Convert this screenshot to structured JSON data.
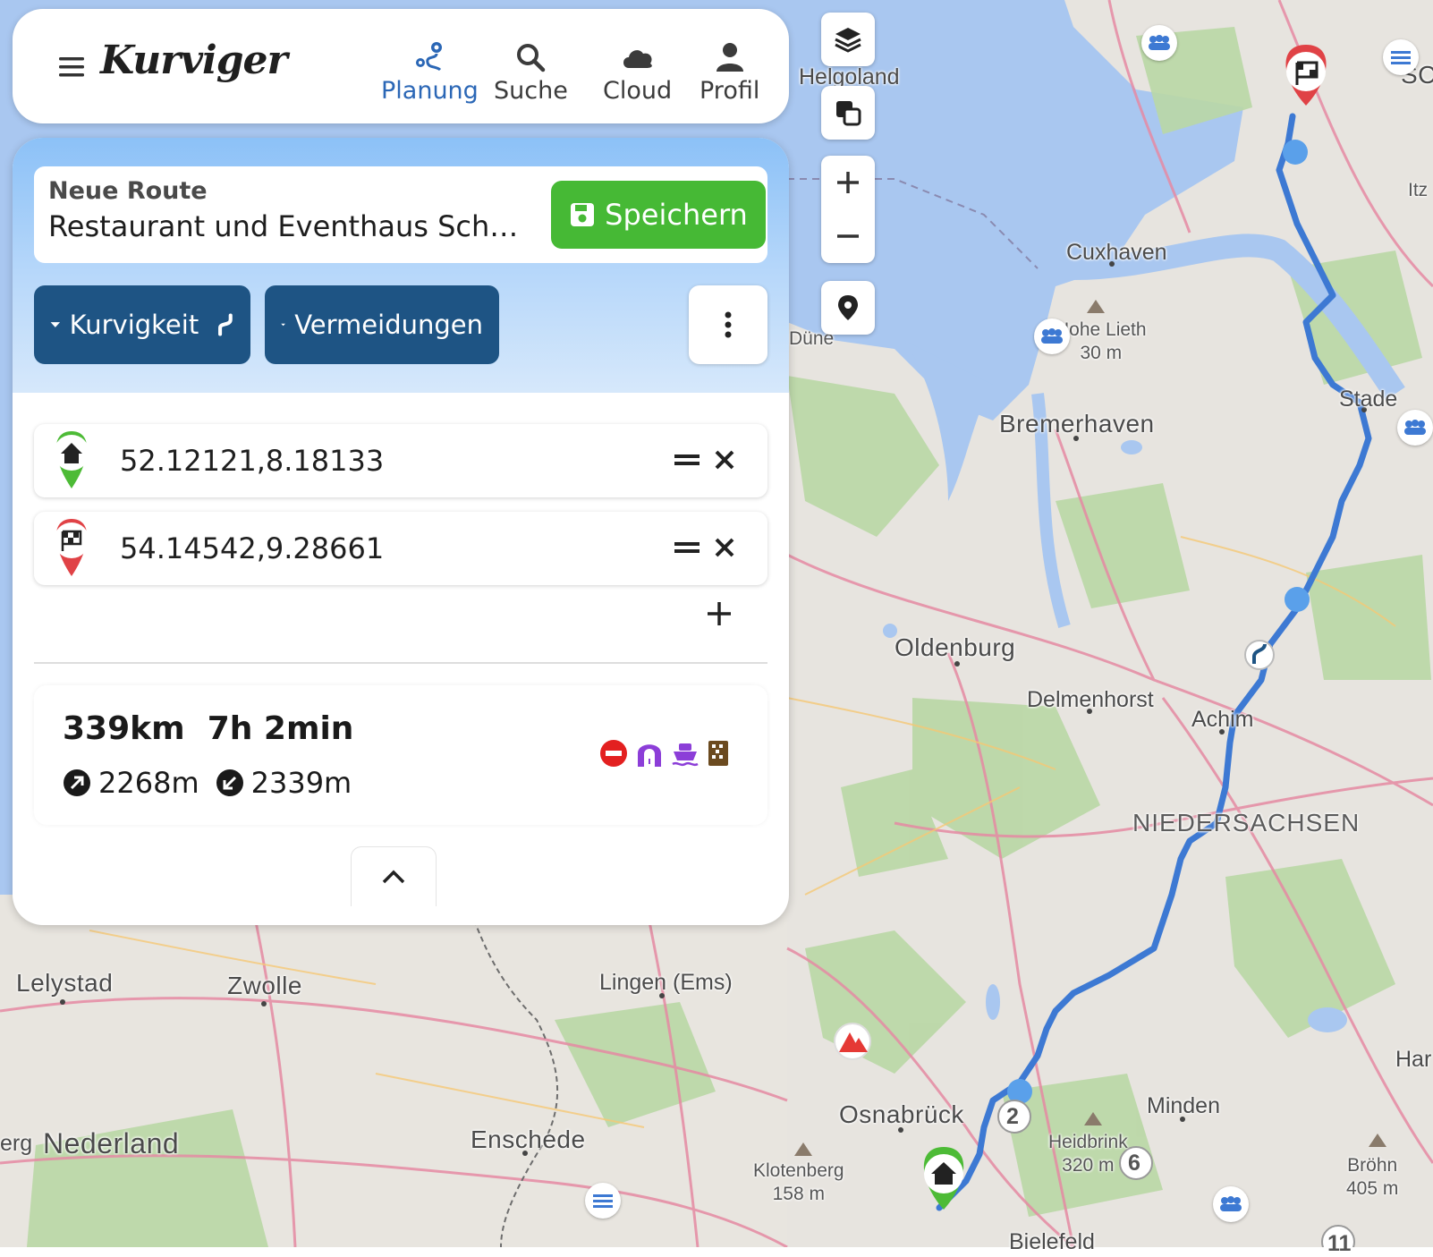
{
  "nav": {
    "logo": "Kurviger",
    "items": [
      {
        "label": "Planung",
        "icon": "route-icon",
        "active": true
      },
      {
        "label": "Suche",
        "icon": "search-icon",
        "active": false
      },
      {
        "label": "Cloud",
        "icon": "cloud-icon",
        "active": false
      },
      {
        "label": "Profil",
        "icon": "user-icon",
        "active": false
      }
    ]
  },
  "route": {
    "label": "Neue Route",
    "name": "Restaurant und Eventhaus Scha…",
    "save_label": "Speichern",
    "curviness_label": "Kurvigkeit",
    "avoidances_label": "Vermeidungen"
  },
  "waypoints": [
    {
      "coord": "52.12121,8.18133",
      "type": "start",
      "icon": "home-icon"
    },
    {
      "coord": "54.14542,9.28661",
      "type": "destination",
      "icon": "flag-icon"
    }
  ],
  "summary": {
    "distance": "339km",
    "duration": "7h 2min",
    "ascent": "2268m",
    "descent": "2339m",
    "flag_icons": [
      "no-entry-icon",
      "tunnel-icon",
      "ferry-icon",
      "toll-icon"
    ]
  },
  "map_controls": [
    "layers-icon",
    "copy-icon",
    "zoom-in-icon",
    "zoom-out-icon",
    "location-icon"
  ],
  "map_labels": {
    "helgoland": "Helgoland",
    "cuxhaven": "Cuxhaven",
    "bremerhaven": "Bremerhaven",
    "oldenburg": "Oldenburg",
    "delmenhorst": "Delmenhorst",
    "achim": "Achim",
    "stade": "Stade",
    "niedersachsen": "NIEDERSACHSEN",
    "lelystad": "Lelystad",
    "zwolle": "Zwolle",
    "lingen": "Lingen (Ems)",
    "nederland": "Nederland",
    "enschede": "Enschede",
    "osnabrueck": "Osnabrück",
    "minden": "Minden",
    "bielefeld": "Bielefeld",
    "hohe_lieth": "Hohe Lieth",
    "hohe_lieth_elev": "30 m",
    "heidbrink": "Heidbrink",
    "heidbrink_elev": "320 m",
    "klotenberg": "Klotenberg",
    "klotenberg_elev": "158 m",
    "broehn": "Bröhn",
    "broehn_elev": "405 m",
    "duene": "Düne",
    "itz": "Itz",
    "sc": "SC",
    "har": "Har",
    "erg": "erg",
    "marker_2": "2",
    "marker_6": "6",
    "marker_11": "11"
  }
}
